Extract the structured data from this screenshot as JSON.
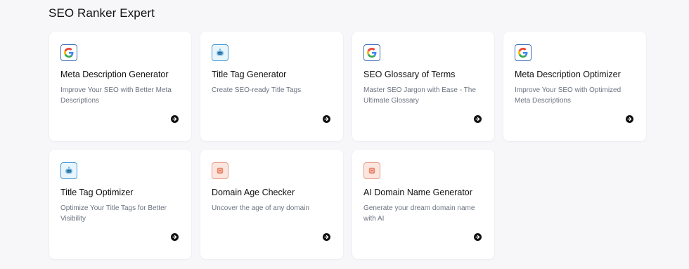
{
  "section": {
    "title": "SEO Ranker Expert"
  },
  "cards": [
    {
      "title": "Meta Description Generator",
      "description": "Improve Your SEO with Better Meta Descriptions",
      "icon": "google-icon"
    },
    {
      "title": "Title Tag Generator",
      "description": "Create SEO-ready Title Tags",
      "icon": "robot-icon"
    },
    {
      "title": "SEO Glossary of Terms",
      "description": "Master SEO Jargon with Ease - The Ultimate Glossary",
      "icon": "google-icon"
    },
    {
      "title": "Meta Description Optimizer",
      "description": "Improve Your SEO with Optimized Meta Descriptions",
      "icon": "google-icon"
    },
    {
      "title": "Title Tag Optimizer",
      "description": "Optimize Your Title Tags for Better Visibility",
      "icon": "robot-icon"
    },
    {
      "title": "Domain Age Checker",
      "description": "Uncover the age of any domain",
      "icon": "domain-icon"
    },
    {
      "title": "AI Domain Name Generator",
      "description": "Generate your dream domain name with AI",
      "icon": "domain-icon"
    }
  ],
  "colors": {
    "background": "#f7f7f9",
    "card": "#ffffff",
    "google_blue": "#4285F4",
    "google_red": "#EA4335",
    "google_yellow": "#FBBC05",
    "google_green": "#34A853",
    "robot_blue": "#4a9bd6",
    "domain_orange": "#e07a5f"
  }
}
